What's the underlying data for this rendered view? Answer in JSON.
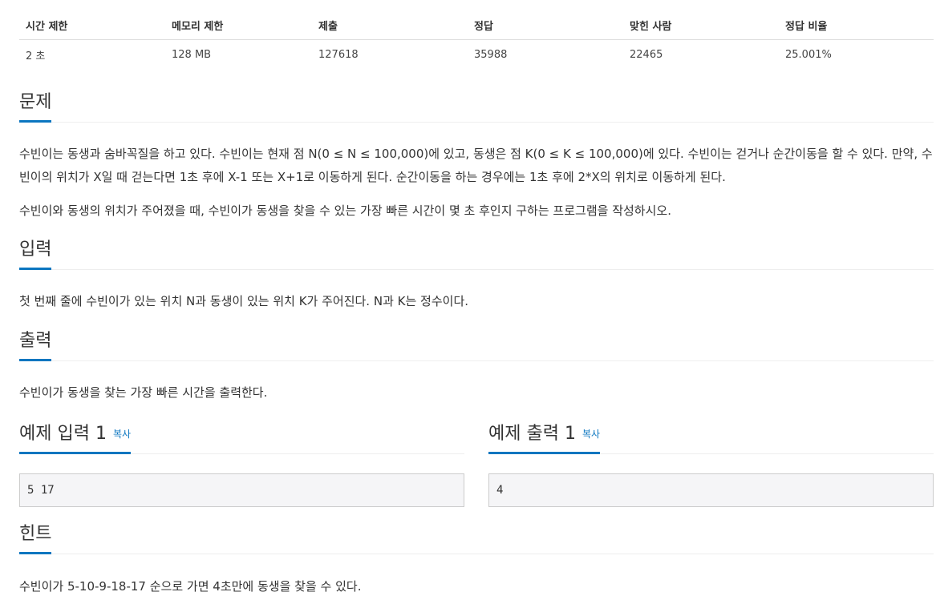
{
  "stats": {
    "headers": [
      "시간 제한",
      "메모리 제한",
      "제출",
      "정답",
      "맞힌 사람",
      "정답 비율"
    ],
    "values": [
      "2 초",
      "128 MB",
      "127618",
      "35988",
      "22465",
      "25.001%"
    ]
  },
  "problem": {
    "title": "문제",
    "p1": "수빈이는 동생과 숨바꼭질을 하고 있다. 수빈이는 현재 점 N(0 ≤ N ≤ 100,000)에 있고, 동생은 점 K(0 ≤ K ≤ 100,000)에 있다. 수빈이는 걷거나 순간이동을 할 수 있다. 만약, 수빈이의 위치가 X일 때 걷는다면 1초 후에 X-1 또는 X+1로 이동하게 된다. 순간이동을 하는 경우에는 1초 후에 2*X의 위치로 이동하게 된다.",
    "p2": "수빈이와 동생의 위치가 주어졌을 때, 수빈이가 동생을 찾을 수 있는 가장 빠른 시간이 몇 초 후인지 구하는 프로그램을 작성하시오."
  },
  "input": {
    "title": "입력",
    "text": "첫 번째 줄에 수빈이가 있는 위치 N과 동생이 있는 위치 K가 주어진다. N과 K는 정수이다."
  },
  "output": {
    "title": "출력",
    "text": "수빈이가 동생을 찾는 가장 빠른 시간을 출력한다."
  },
  "sample_input": {
    "title": "예제 입력 1",
    "copy_label": "복사",
    "value": "5 17"
  },
  "sample_output": {
    "title": "예제 출력 1",
    "copy_label": "복사",
    "value": "4"
  },
  "hint": {
    "title": "힌트",
    "text": "수빈이가 5-10-9-18-17 순으로 가면 4초만에 동생을 찾을 수 있다."
  },
  "colors": {
    "accent": "#0b76c0",
    "sample_bg": "#f5f5f7"
  }
}
